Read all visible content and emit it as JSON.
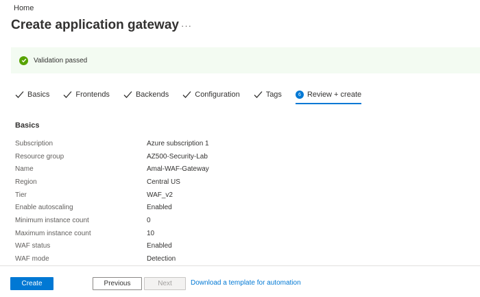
{
  "breadcrumb": "Home",
  "page_title": "Create application gateway",
  "more_label": "···",
  "banner": {
    "message": "Validation passed",
    "icon": "check-circle-icon",
    "color": "#57a300"
  },
  "tabs": [
    {
      "label": "Basics",
      "state": "complete"
    },
    {
      "label": "Frontends",
      "state": "complete"
    },
    {
      "label": "Backends",
      "state": "complete"
    },
    {
      "label": "Configuration",
      "state": "complete"
    },
    {
      "label": "Tags",
      "state": "complete"
    },
    {
      "label": "Review + create",
      "state": "active",
      "step": "6"
    }
  ],
  "section": {
    "title": "Basics",
    "rows": [
      {
        "key": "Subscription",
        "value": "Azure subscription 1"
      },
      {
        "key": "Resource group",
        "value": "AZ500-Security-Lab"
      },
      {
        "key": "Name",
        "value": "Amal-WAF-Gateway"
      },
      {
        "key": "Region",
        "value": "Central US"
      },
      {
        "key": "Tier",
        "value": "WAF_v2"
      },
      {
        "key": "Enable autoscaling",
        "value": "Enabled"
      },
      {
        "key": "Minimum instance count",
        "value": "0"
      },
      {
        "key": "Maximum instance count",
        "value": "10"
      },
      {
        "key": "WAF status",
        "value": "Enabled"
      },
      {
        "key": "WAF mode",
        "value": "Detection"
      }
    ]
  },
  "footer": {
    "create_label": "Create",
    "previous_label": "Previous",
    "next_label": "Next",
    "template_link": "Download a template for automation"
  },
  "colors": {
    "accent": "#0078d4",
    "success": "#57a300"
  }
}
